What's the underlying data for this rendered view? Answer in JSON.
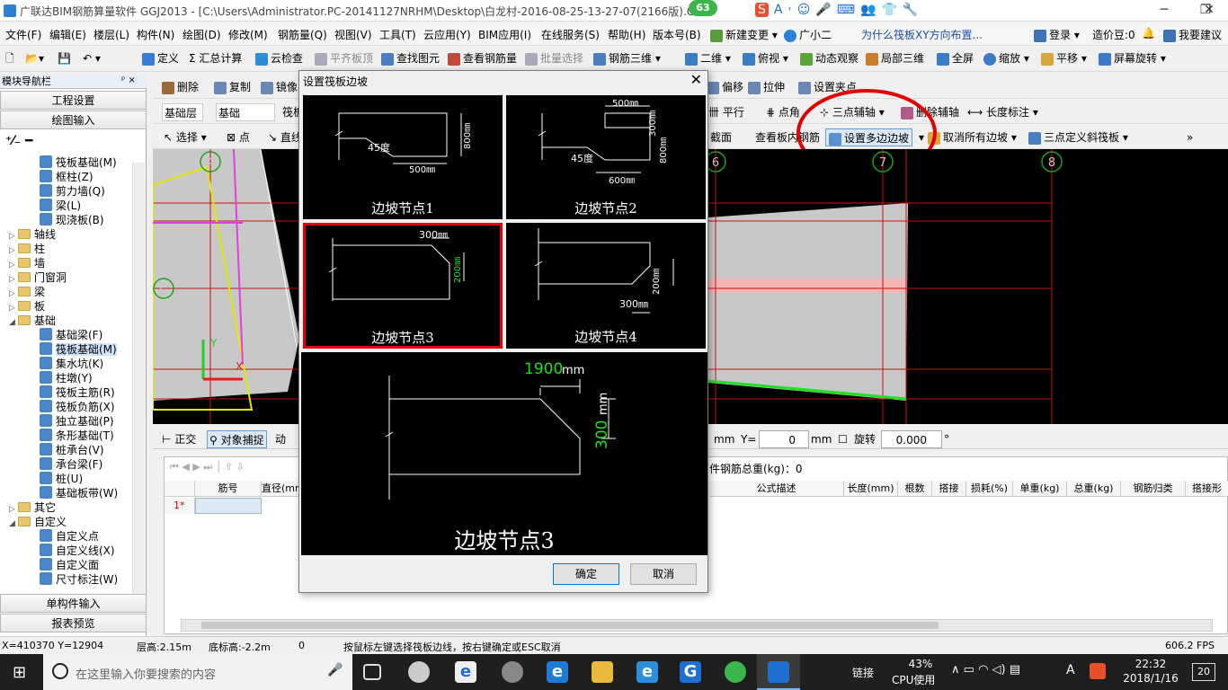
{
  "window": {
    "title": "广联达BIM钢筋算量软件 GGJ2013 - [C:\\Users\\Administrator.PC-20141127NRHM\\Desktop\\白龙村-2016-08-25-13-27-07(2166版).GG",
    "badge": "63",
    "minimize": "─",
    "restore": "❐",
    "close": "✕"
  },
  "ime": {
    "logo": "S",
    "items": [
      "A",
      "˒",
      "☺",
      "🎤",
      "⌨",
      "👥",
      "👕",
      "🔧"
    ]
  },
  "menu": [
    "文件(F)",
    "编辑(E)",
    "楼层(L)",
    "构件(N)",
    "绘图(D)",
    "修改(M)",
    "钢筋量(Q)",
    "视图(V)",
    "工具(T)",
    "云应用(Y)",
    "BIM应用(I)",
    "在线服务(S)",
    "帮助(H)",
    "版本号(B)",
    "新建变更",
    "广小二",
    "为什么筏板XY方向布置...",
    "登录",
    "造价豆:0",
    "我要建议"
  ],
  "toolbar1": [
    "定义",
    "Σ 汇总计算",
    "云检查",
    "平齐板顶",
    "查找图元",
    "查看钢筋量",
    "批量选择",
    "钢筋三维",
    "二维",
    "俯视",
    "动态观察",
    "局部三维",
    "全屏",
    "缩放",
    "平移",
    "屏幕旋转"
  ],
  "toolbar2": [
    "删除",
    "复制",
    "镜像",
    "偏移",
    "拉伸",
    "设置夹点"
  ],
  "toolbar3": {
    "floor": "基础层",
    "type": "基础",
    "type2": "筏板",
    "items": [
      "平行",
      "点角",
      "三点辅轴",
      "删除辅轴",
      "长度标注"
    ]
  },
  "toolbar4": [
    "选择",
    "点",
    "直线",
    "截面",
    "查看板内钢筋",
    "设置多边边坡",
    "取消所有边坡",
    "三点定义斜筏板"
  ],
  "leftpanel": {
    "title": "模块导航栏",
    "pin": "ᵖ ×",
    "buttons": [
      "工程设置",
      "绘图输入"
    ],
    "bottom_buttons": [
      "单构件输入",
      "报表预览"
    ],
    "tree": [
      {
        "label": "筏板基础(M)",
        "kind": "leaf",
        "indent": 3
      },
      {
        "label": "框柱(Z)",
        "kind": "leaf",
        "indent": 3
      },
      {
        "label": "剪力墙(Q)",
        "kind": "leaf",
        "indent": 3
      },
      {
        "label": "梁(L)",
        "kind": "leaf",
        "indent": 3
      },
      {
        "label": "现浇板(B)",
        "kind": "leaf",
        "indent": 3
      },
      {
        "label": "轴线",
        "kind": "folder",
        "indent": 1,
        "tw": "▷"
      },
      {
        "label": "柱",
        "kind": "folder",
        "indent": 1,
        "tw": "▷"
      },
      {
        "label": "墙",
        "kind": "folder",
        "indent": 1,
        "tw": "▷"
      },
      {
        "label": "门窗洞",
        "kind": "folder",
        "indent": 1,
        "tw": "▷"
      },
      {
        "label": "梁",
        "kind": "folder",
        "indent": 1,
        "tw": "▷"
      },
      {
        "label": "板",
        "kind": "folder",
        "indent": 1,
        "tw": "▷"
      },
      {
        "label": "基础",
        "kind": "folder",
        "indent": 1,
        "tw": "◢"
      },
      {
        "label": "基础梁(F)",
        "kind": "leaf",
        "indent": 3
      },
      {
        "label": "筏板基础(M)",
        "kind": "leaf",
        "indent": 3,
        "selected": true
      },
      {
        "label": "集水坑(K)",
        "kind": "leaf",
        "indent": 3
      },
      {
        "label": "柱墩(Y)",
        "kind": "leaf",
        "indent": 3
      },
      {
        "label": "筏板主筋(R)",
        "kind": "leaf",
        "indent": 3
      },
      {
        "label": "筏板负筋(X)",
        "kind": "leaf",
        "indent": 3
      },
      {
        "label": "独立基础(P)",
        "kind": "leaf",
        "indent": 3
      },
      {
        "label": "条形基础(T)",
        "kind": "leaf",
        "indent": 3
      },
      {
        "label": "桩承台(V)",
        "kind": "leaf",
        "indent": 3
      },
      {
        "label": "承台梁(F)",
        "kind": "leaf",
        "indent": 3
      },
      {
        "label": "桩(U)",
        "kind": "leaf",
        "indent": 3
      },
      {
        "label": "基础板带(W)",
        "kind": "leaf",
        "indent": 3
      },
      {
        "label": "其它",
        "kind": "folder",
        "indent": 1,
        "tw": "▷"
      },
      {
        "label": "自定义",
        "kind": "folder",
        "indent": 1,
        "tw": "◢"
      },
      {
        "label": "自定义点",
        "kind": "leaf",
        "indent": 3
      },
      {
        "label": "自定义线(X)",
        "kind": "leaf",
        "indent": 3
      },
      {
        "label": "自定义面",
        "kind": "leaf",
        "indent": 3
      },
      {
        "label": "尺寸标注(W)",
        "kind": "leaf",
        "indent": 3
      }
    ]
  },
  "canvas": {
    "axis_labels": [
      "4",
      "6",
      "7",
      "8",
      "C"
    ],
    "axes": {
      "y": "Y",
      "x": "X"
    }
  },
  "bottom_toolbar": {
    "ortho": "正交",
    "snap": "对象捕捉",
    "dyn": "动",
    "mm1": "mm",
    "y_label": "Y=",
    "y_value": "0",
    "mm2": "mm",
    "rotate_label": "旋转",
    "rotate_value": "0.000",
    "degree": "°"
  },
  "grid": {
    "total_label": "件钢筋总重(kg)：0",
    "headers_left": [
      "筋号",
      "直径(mm"
    ],
    "headers_right": [
      "公式描述",
      "长度(mm)",
      "根数",
      "搭接",
      "损耗(%)",
      "单重(kg)",
      "总重(kg)",
      "钢筋归类",
      "搭接形"
    ],
    "row1": "1*"
  },
  "dialog": {
    "title": "设置筏板边坡",
    "close": "✕",
    "nodes": [
      {
        "caption": "边坡节点1",
        "dim_a": "45度",
        "dim_b": "500㎜",
        "dim_c": "800㎜"
      },
      {
        "caption": "边坡节点2",
        "dim_a": "500㎜",
        "dim_b": "300㎜",
        "dim_c": "600㎜",
        "dim_d": "45度",
        "dim_e": "800㎜"
      },
      {
        "caption": "边坡节点3",
        "dim_a": "300㎜",
        "dim_b": "200㎜"
      },
      {
        "caption": "边坡节点4",
        "dim_a": "200㎜",
        "dim_b": "300㎜"
      }
    ],
    "preview": {
      "caption": "边坡节点3",
      "width_value": "1900",
      "width_unit": "mm",
      "height_value": "300",
      "height_unit": "mm"
    },
    "ok": "确定",
    "cancel": "取消"
  },
  "status": {
    "coords": "X=410370 Y=12904",
    "floor_height": "层高:2.15m",
    "bottom_height": "底标高:-2.2m",
    "zero": "0",
    "hint": "按鼠标左键选择筏板边线，按右键确定或ESC取消",
    "fps": "606.2 FPS"
  },
  "taskbar": {
    "search_placeholder": "在这里输入你要搜索的内容",
    "network": "链接",
    "cpu_pct": "43%",
    "cpu_label": "CPU使用",
    "ime": "A",
    "time": "22:32",
    "date": "2018/1/16",
    "notify": "20"
  },
  "colors": {
    "accent": "#0078d7",
    "selected_border": "#e00000",
    "green_dim": "#00d000",
    "slab_fill": "#c8c8c8"
  }
}
